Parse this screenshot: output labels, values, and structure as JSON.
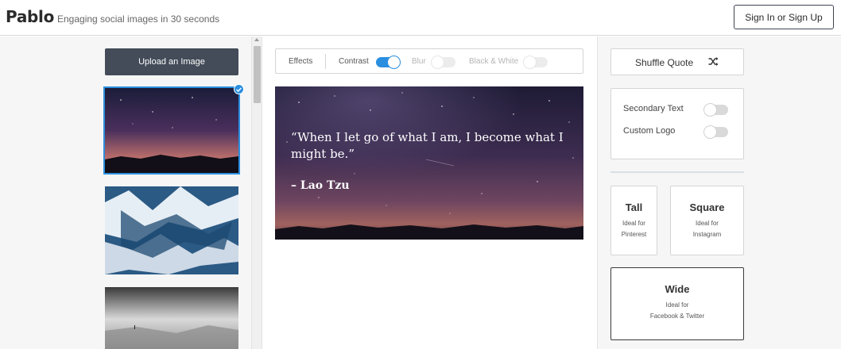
{
  "header": {
    "logo": "Pablo",
    "tagline": "Engaging social images in 30 seconds",
    "signin_label": "Sign In or Sign Up"
  },
  "left": {
    "upload_label": "Upload an Image"
  },
  "effects": {
    "effects_label": "Effects",
    "contrast_label": "Contrast",
    "contrast_on": true,
    "blur_label": "Blur",
    "blur_on": false,
    "bw_label": "Black & White",
    "bw_on": false
  },
  "canvas": {
    "quote": "“When I let go of what I am, I become what I might be.”",
    "author": "– Lao Tzu"
  },
  "right": {
    "shuffle_label": "Shuffle Quote",
    "secondary_text_label": "Secondary Text",
    "custom_logo_label": "Custom Logo",
    "sizes": [
      {
        "title": "Tall",
        "line1": "Ideal for",
        "line2": "Pinterest"
      },
      {
        "title": "Square",
        "line1": "Ideal for",
        "line2": "Instagram"
      },
      {
        "title": "Wide",
        "line1": "Ideal for",
        "line2": "Facebook & Twitter"
      }
    ],
    "selected_size": "Wide"
  },
  "colors": {
    "accent": "#2b8fe0",
    "button_dark": "#434c58"
  }
}
